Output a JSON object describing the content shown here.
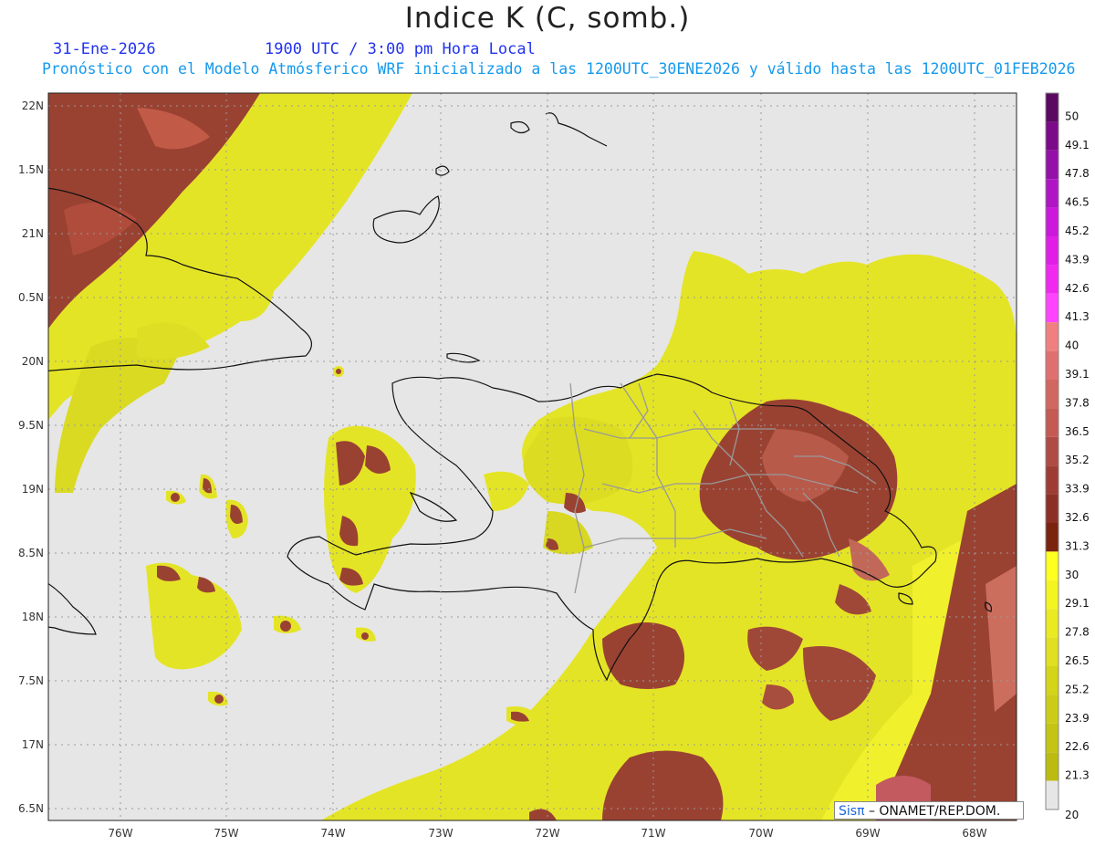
{
  "header": {
    "title": "Indice K (C, somb.)",
    "date": "31-Ene-2026",
    "time": "1900 UTC / 3:00 pm Hora Local",
    "description": "Pronóstico con el Modelo Atmósferico WRF inicializado a las 1200UTC_30ENE2026 y válido hasta las  1200UTC_01FEB2026"
  },
  "lat_labels": [
    "22N",
    "1.5N",
    "21N",
    "0.5N",
    "20N",
    "9.5N",
    "19N",
    "8.5N",
    "18N",
    "7.5N",
    "17N",
    "6.5N"
  ],
  "lon_labels": [
    "76W",
    "75W",
    "74W",
    "73W",
    "72W",
    "71W",
    "70W",
    "69W",
    "68W"
  ],
  "colorbar": {
    "labels": [
      "50",
      "49.1",
      "47.8",
      "46.5",
      "45.2",
      "43.9",
      "42.6",
      "41.3",
      "40",
      "39.1",
      "37.8",
      "36.5",
      "35.2",
      "33.9",
      "32.6",
      "31.3",
      "30",
      "29.1",
      "27.8",
      "26.5",
      "25.2",
      "23.9",
      "22.6",
      "21.3",
      "20"
    ],
    "colors": [
      "#5a0860",
      "#7a0a88",
      "#9410a8",
      "#b014c4",
      "#cc18dc",
      "#e01ee8",
      "#f028f0",
      "#ff44ff",
      "#f08080",
      "#e07070",
      "#d26660",
      "#c45a52",
      "#b04a44",
      "#9e3c34",
      "#8c3026",
      "#7a2410",
      "#ffff20",
      "#f4f420",
      "#eaea20",
      "#e0e020",
      "#d4d418",
      "#cccc18",
      "#c4c414",
      "#bcbc10",
      "#e6e6e6"
    ]
  },
  "credit": {
    "brand": "Sisπ",
    "org": "– ONAMET/REP.DOM."
  },
  "colors": {
    "background": "#e6e6e6",
    "yellow": "#e8e828",
    "brown": "#a04838",
    "brand_blue": "#1a66dd"
  }
}
